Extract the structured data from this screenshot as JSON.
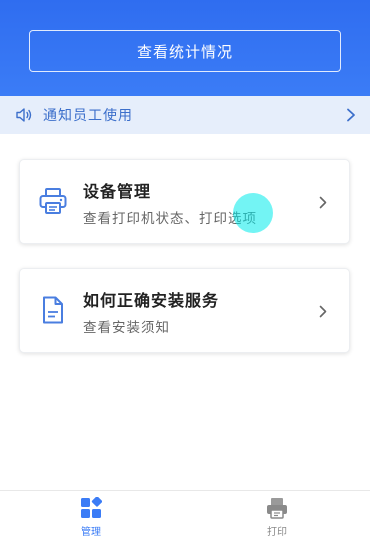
{
  "header": {
    "stats_button_label": "查看统计情况"
  },
  "notice": {
    "text": "通知员工使用"
  },
  "cards": [
    {
      "title": "设备管理",
      "subtitle": "查看打印机状态、打印选项"
    },
    {
      "title": "如何正确安装服务",
      "subtitle": "查看安装须知"
    }
  ],
  "tabbar": {
    "tabs": [
      {
        "label": "管理",
        "active": true
      },
      {
        "label": "打印",
        "active": false
      }
    ]
  },
  "colors": {
    "primary": "#3b7cf6",
    "notice_bg": "#e6eefb",
    "notice_text": "#3c6fcb",
    "tap_highlight": "#00ebeb"
  }
}
